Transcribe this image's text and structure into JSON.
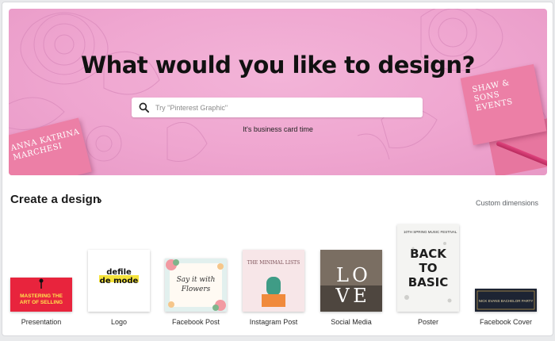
{
  "hero": {
    "title": "What would you like to design?",
    "search_placeholder": "Try \"Pinterest Graphic\"",
    "hint": "It's business card time",
    "card_left_text": [
      "ANNA KATRINA",
      "MARCHESI"
    ],
    "card_right_text": [
      "SHAW &",
      "SONS",
      "EVENTS"
    ]
  },
  "section": {
    "title": "Create a design",
    "chevron": "›",
    "custom_dimensions": "Custom dimensions"
  },
  "design_types": [
    {
      "label": "Presentation",
      "thumb_text": "MASTERING THE ART OF SELLING"
    },
    {
      "label": "Logo",
      "thumb_text": "defile de mode"
    },
    {
      "label": "Facebook Post",
      "thumb_text": "Say it with Flowers"
    },
    {
      "label": "Instagram Post",
      "thumb_text": "THE MINIMAL LISTS"
    },
    {
      "label": "Social Media",
      "thumb_text": "LOVE"
    },
    {
      "label": "Poster",
      "thumb_text": "BACK TO BASIC",
      "thumb_header": "10TH SPRING MUSIC FESTIVAL"
    },
    {
      "label": "Facebook Cover",
      "thumb_text": "NICK EVANS BACHELOR PARTY"
    }
  ],
  "colors": {
    "hero_pink": "#efa6d0",
    "card_pink": "#ec7fa6",
    "presentation_red": "#e8243d"
  },
  "icons": {
    "search": "search-icon"
  }
}
